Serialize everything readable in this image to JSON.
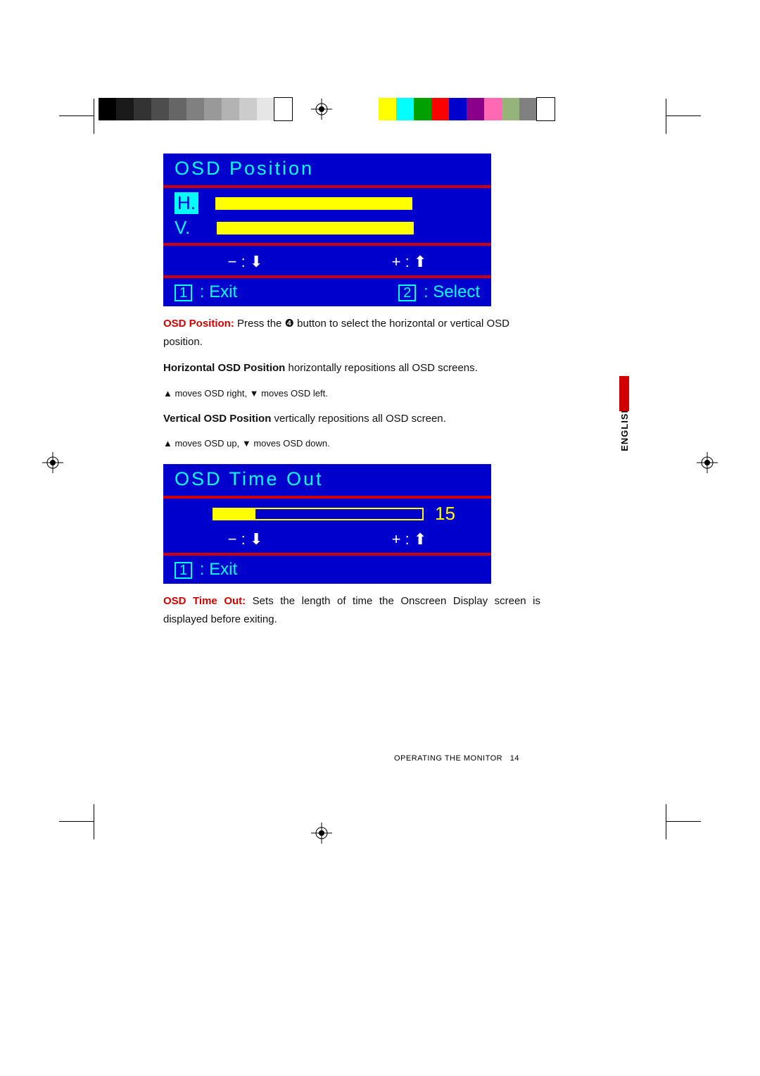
{
  "osd1": {
    "title": "OSD Position",
    "rows": [
      {
        "label": "H.",
        "selected": true,
        "fill_pct": 100
      },
      {
        "label": "V.",
        "selected": false,
        "fill_pct": 100
      }
    ],
    "hint_minus": "− :",
    "hint_plus": "+ :",
    "exit_key": "1",
    "exit_label": " : Exit",
    "select_key": "2",
    "select_label": " : Select"
  },
  "osd2": {
    "title": "OSD Time Out",
    "fill_pct": 20,
    "value": "15",
    "hint_minus": "− :",
    "hint_plus": "+ :",
    "exit_key": "1",
    "exit_label": " : Exit"
  },
  "text": {
    "p1_lead": "OSD Position:",
    "p1_rest": " Press the ❹ button to select the horizontal or vertical OSD position.",
    "p2_bold": "Horizontal OSD Position",
    "p2_rest": " horizontally repositions all OSD screens.",
    "p3": "▲ moves OSD right, ▼  moves OSD left.",
    "p4_bold": "Vertical OSD Position",
    "p4_rest": " vertically repositions all OSD screen.",
    "p5": "▲ moves OSD up, ▼ moves OSD down.",
    "p6_lead": "OSD Time Out:",
    "p6_rest": " Sets the length of time the Onscreen Display screen is displayed before exiting."
  },
  "language_tab": "ENGLISH",
  "footer": {
    "section": "OPERATING THE MONITOR",
    "page": "14"
  },
  "colorbars": {
    "gray": [
      "#000000",
      "#1a1a1a",
      "#333333",
      "#4d4d4d",
      "#666666",
      "#808080",
      "#999999",
      "#b3b3b3",
      "#cccccc",
      "#e6e6e6",
      "#ffffff"
    ],
    "color": [
      "#ffff00",
      "#00ffff",
      "#00a000",
      "#ff0000",
      "#0000cc",
      "#8b008b",
      "#ff69b4",
      "#94b47c",
      "#808080",
      "#ffffff"
    ]
  }
}
